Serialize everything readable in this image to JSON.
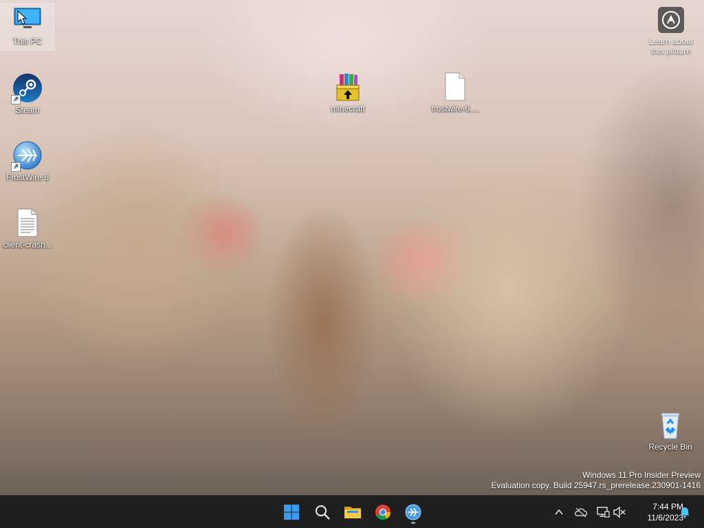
{
  "desktop": {
    "icons": {
      "this_pc": "This PC",
      "steam": "Steam",
      "frostwire": "FrostWire 6",
      "client_crash": "client-crash...",
      "minecraft": "minecraft",
      "frostwire_file": "frostwire-6....",
      "recycle_bin": "Recycle Bin"
    },
    "learn_about": [
      "Learn about",
      "this picture"
    ],
    "watermark": {
      "line1": "Windows 11 Pro Insider Preview",
      "line2": "Evaluation copy. Build 25947.rs_prerelease.230901-1416"
    }
  },
  "taskbar": {
    "apps": [
      "windows-start-icon",
      "search-icon",
      "file-explorer-icon",
      "chrome-icon",
      "frostwire-icon"
    ],
    "tray_icons": [
      "chevron-up-icon",
      "onedrive-cloud-icon",
      "network-icon",
      "volume-muted-icon",
      "bell-icon"
    ],
    "clock": {
      "time": "7:44 PM",
      "date": "11/6/2023"
    }
  },
  "colors": {
    "taskbar_bg": "#1f1f1f",
    "start_blue": "#3a9bf0",
    "notification_blue": "#4cc2ff"
  }
}
